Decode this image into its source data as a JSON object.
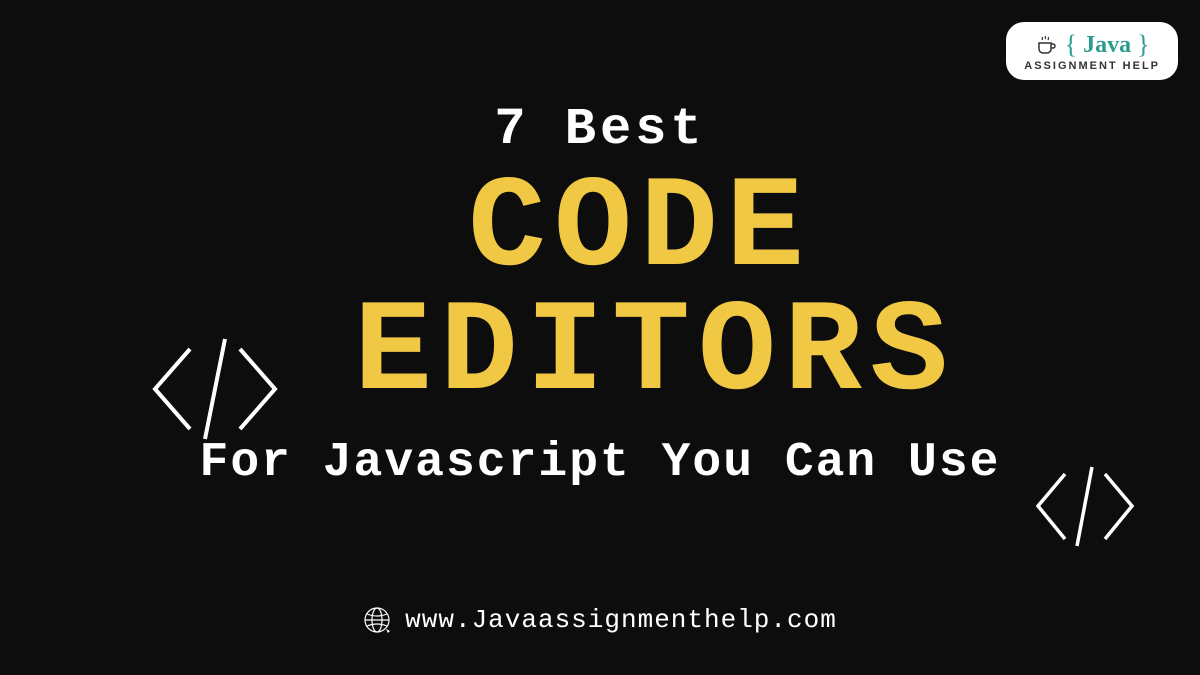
{
  "logo": {
    "java_word": "Java",
    "brace_open": "{",
    "brace_close": "}",
    "subtitle": "ASSIGNMENT HELP"
  },
  "heading": {
    "line1": "7 Best",
    "word1": "CODE",
    "word2": "EDITORS",
    "line3": "For Javascript You Can Use"
  },
  "footer": {
    "url": "www.Javaassignmenthelp.com"
  },
  "icons": {
    "code_tag_left": "code-tag-icon",
    "code_tag_right": "code-tag-icon",
    "globe": "globe-icon",
    "cup": "coffee-cup-icon"
  }
}
